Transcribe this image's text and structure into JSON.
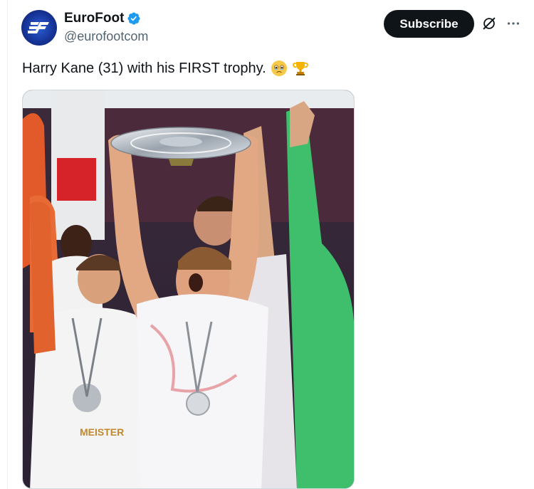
{
  "account": {
    "display_name": "EuroFoot",
    "handle": "@eurofootcom",
    "verified_icon": "verified-badge-icon",
    "avatar_logo": "EF",
    "avatar_icon": "eurofoot-logo"
  },
  "actions": {
    "subscribe_label": "Subscribe",
    "grok_icon": "grok-icon",
    "more_icon": "more-options-icon"
  },
  "post": {
    "text": "Harry Kane (31) with his FIRST trophy.",
    "emojis": [
      "holding-back-tears-emoji",
      "trophy-emoji"
    ]
  },
  "media": {
    "description_icon": "celebration-photo",
    "shirt_text": "MEISTER"
  },
  "colors": {
    "subscribe_bg": "#0f1419",
    "verified_blue": "#1d9bf0",
    "handle_gray": "#536471"
  }
}
